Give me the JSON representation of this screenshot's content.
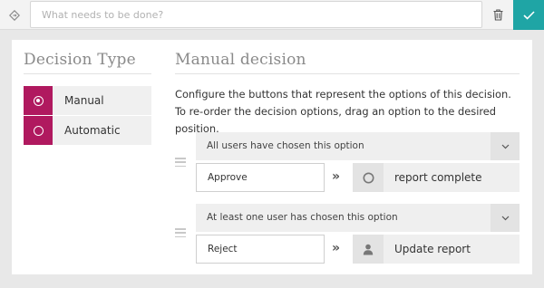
{
  "topbar": {
    "search_placeholder": "What needs to be done?",
    "search_value": "",
    "confirm_color": "#1fa5a5"
  },
  "left_panel": {
    "title": "Decision Type",
    "options": [
      {
        "label": "Manual",
        "selected": true
      },
      {
        "label": "Automatic",
        "selected": false
      }
    ],
    "accent_color": "#b0195f"
  },
  "right_panel": {
    "title": "Manual decision",
    "description": "Configure the buttons that represent the options of this decision. To re-order the decision options, drag an option to the desired position.",
    "decision_options": [
      {
        "condition": "All users have chosen this option",
        "name": "Approve",
        "action_icon": "circle-icon",
        "action_label": "report complete"
      },
      {
        "condition": "At least one user has chosen this option",
        "name": "Reject",
        "action_icon": "user-icon",
        "action_label": "Update report"
      }
    ]
  }
}
